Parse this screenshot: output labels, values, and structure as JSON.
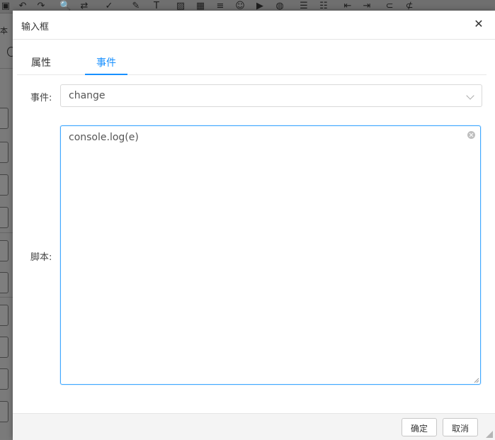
{
  "background": {
    "toolbar_icons": [
      {
        "icon": "save-icon",
        "glyph": "▣"
      },
      {
        "icon": "undo-icon",
        "glyph": "↶"
      },
      {
        "icon": "redo-icon",
        "glyph": "↷"
      },
      {
        "icon": "search-icon",
        "glyph": "🔍"
      },
      {
        "icon": "replace-icon",
        "glyph": "⇄"
      },
      {
        "icon": "spellcheck-icon",
        "glyph": "✓"
      },
      {
        "icon": "paint-brush-icon",
        "glyph": "✎"
      },
      {
        "icon": "clear-format-icon",
        "glyph": "T"
      },
      {
        "icon": "image-icon",
        "glyph": "▨"
      },
      {
        "icon": "table-icon",
        "glyph": "▦"
      },
      {
        "icon": "horizontal-rule-icon",
        "glyph": "≡"
      },
      {
        "icon": "emoji-icon",
        "glyph": "☺"
      },
      {
        "icon": "media-icon",
        "glyph": "▶"
      },
      {
        "icon": "link-globe-icon",
        "glyph": "◍"
      },
      {
        "icon": "ordered-list-icon",
        "glyph": "☰"
      },
      {
        "icon": "unordered-list-icon",
        "glyph": "☷"
      },
      {
        "icon": "outdent-icon",
        "glyph": "⇤"
      },
      {
        "icon": "indent-icon",
        "glyph": "⇥"
      },
      {
        "icon": "link-icon",
        "glyph": "⊂"
      },
      {
        "icon": "unlink-icon",
        "glyph": "⊄"
      }
    ],
    "left_label": "本"
  },
  "dialog": {
    "title": "输入框",
    "close_glyph": "✕",
    "tabs": [
      {
        "label": "属性",
        "active": false
      },
      {
        "label": "事件",
        "active": true
      }
    ],
    "event_label": "事件:",
    "event_value": "change",
    "script_label": "脚本:",
    "script_value": "console.log(e)",
    "confirm_label": "确定",
    "cancel_label": "取消"
  },
  "colors": {
    "accent": "#1890ff",
    "overlay": "#7b7b7b"
  }
}
